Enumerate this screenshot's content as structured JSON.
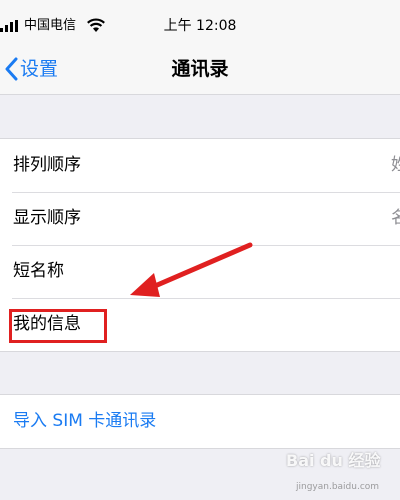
{
  "status_bar": {
    "carrier": "中国电信",
    "time": "上午 12:08"
  },
  "nav": {
    "back_label": "设置",
    "title": "通讯录"
  },
  "settings": {
    "rows": [
      {
        "label": "排列顺序",
        "value": "姓"
      },
      {
        "label": "显示顺序",
        "value": "名"
      },
      {
        "label": "短名称"
      },
      {
        "label": "我的信息"
      }
    ],
    "import_label": "导入 SIM 卡通讯录"
  },
  "watermark": {
    "brand": "Bai du 经验",
    "url": "jingyan.baidu.com"
  },
  "colors": {
    "ios_blue": "#1a7bf2",
    "annotation_red": "#e02020",
    "background": "#efeff4"
  }
}
